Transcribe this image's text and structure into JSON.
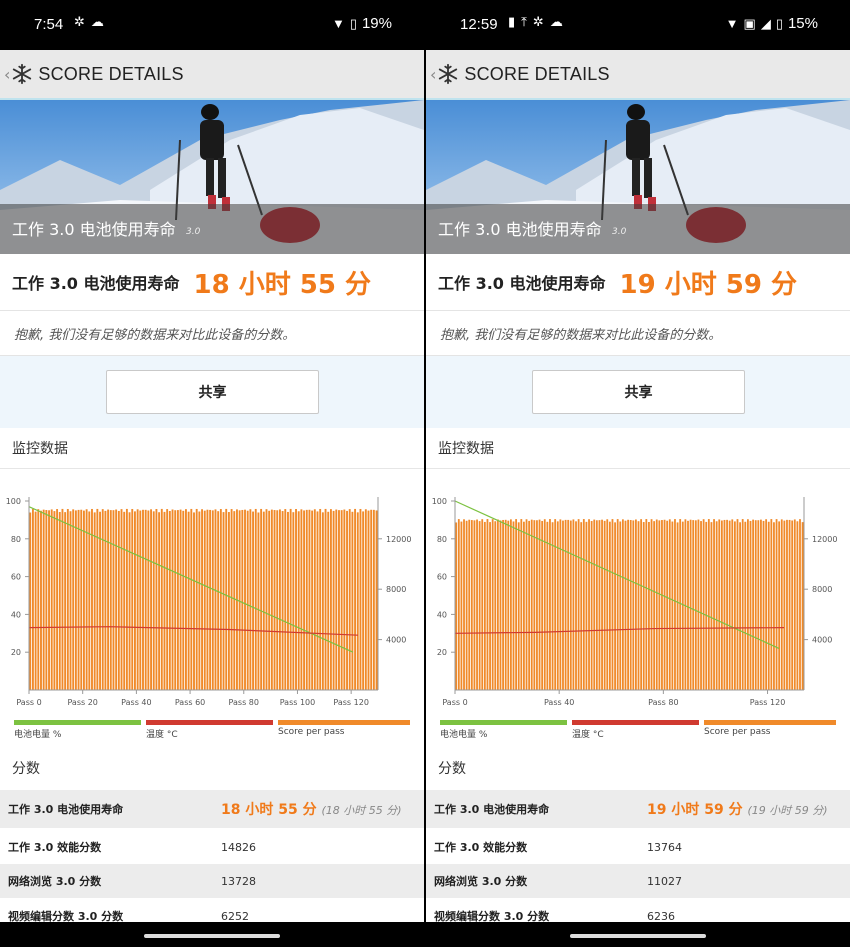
{
  "colors": {
    "accent": "#f07a1a",
    "battery": "#7cc241",
    "temperature": "#d03a30",
    "score": "#f08a2a",
    "appbar": "#e9e9e9"
  },
  "phones": [
    {
      "status": {
        "time": "7:54",
        "battery": "19%",
        "left_icons": [
          "pinwheel-icon",
          "cloud-icon"
        ]
      },
      "appbar": {
        "title": "SCORE DETAILS"
      },
      "hero": {
        "title": "工作 3.0 电池使用寿命",
        "version": "3.0"
      },
      "result": {
        "label": "工作 3.0 电池使用寿命",
        "value": "18 小时 55 分"
      },
      "notice": "抱歉, 我们没有足够的数据来对比此设备的分数。",
      "share_label": "共享",
      "monitor_title": "监控数据",
      "scores_title": "分数",
      "legend": [
        "电池电量 %",
        "温度 °C",
        "Score per pass"
      ],
      "chart_data": {
        "type": "bar",
        "x_ticks": [
          "Pass 0",
          "Pass 20",
          "Pass 40",
          "Pass 60",
          "Pass 80",
          "Pass 100",
          "Pass 120"
        ],
        "passes": 130,
        "y_left_ticks": [
          "100",
          "80",
          "60",
          "40",
          "20"
        ],
        "y_right_ticks": [
          "12000",
          "8000",
          "4000"
        ],
        "ylim_left": [
          0,
          100
        ],
        "ylim_right": [
          0,
          15000
        ],
        "score_per_pass_approx": 14300,
        "battery_percent": {
          "start": 97,
          "end": 20
        },
        "temperature_c": {
          "start": 33,
          "end": 29
        }
      },
      "scores": [
        {
          "name": "工作 3.0 电池使用寿命",
          "value": "18 小时 55 分",
          "sub": "(18 小时 55 分)"
        },
        {
          "name": "工作 3.0 效能分数",
          "value": "14826"
        },
        {
          "name": "网络浏览 3.0 分数",
          "value": "13728"
        },
        {
          "name": "视频编辑分数 3.0 分数",
          "value": "6252"
        }
      ]
    },
    {
      "status": {
        "time": "12:59",
        "battery": "15%",
        "left_icons": [
          "battery-alert-icon",
          "upload-icon",
          "pinwheel-icon",
          "cloud-sun-icon"
        ]
      },
      "appbar": {
        "title": "SCORE DETAILS"
      },
      "hero": {
        "title": "工作 3.0 电池使用寿命",
        "version": "3.0"
      },
      "result": {
        "label": "工作 3.0 电池使用寿命",
        "value": "19 小时 59 分"
      },
      "notice": "抱歉, 我们没有足够的数据来对比此设备的分数。",
      "share_label": "共享",
      "monitor_title": "监控数据",
      "scores_title": "分数",
      "legend": [
        "电池电量 %",
        "温度 °C",
        "Score per pass"
      ],
      "chart_data": {
        "type": "bar",
        "x_ticks": [
          "Pass 0",
          "Pass 40",
          "Pass 80",
          "Pass 120"
        ],
        "passes": 134,
        "y_left_ticks": [
          "100",
          "80",
          "60",
          "40",
          "20"
        ],
        "y_right_ticks": [
          "12000",
          "8000",
          "4000"
        ],
        "ylim_left": [
          0,
          100
        ],
        "ylim_right": [
          0,
          15000
        ],
        "score_per_pass_approx": 13500,
        "battery_percent": {
          "start": 100,
          "end": 22
        },
        "temperature_c": {
          "start": 30,
          "end": 33
        }
      },
      "scores": [
        {
          "name": "工作 3.0 电池使用寿命",
          "value": "19 小时 59 分",
          "sub": "(19 小时 59 分)"
        },
        {
          "name": "工作 3.0 效能分数",
          "value": "13764"
        },
        {
          "name": "网络浏览 3.0 分数",
          "value": "11027"
        },
        {
          "name": "视频编辑分数 3.0 分数",
          "value": "6236"
        }
      ]
    }
  ]
}
